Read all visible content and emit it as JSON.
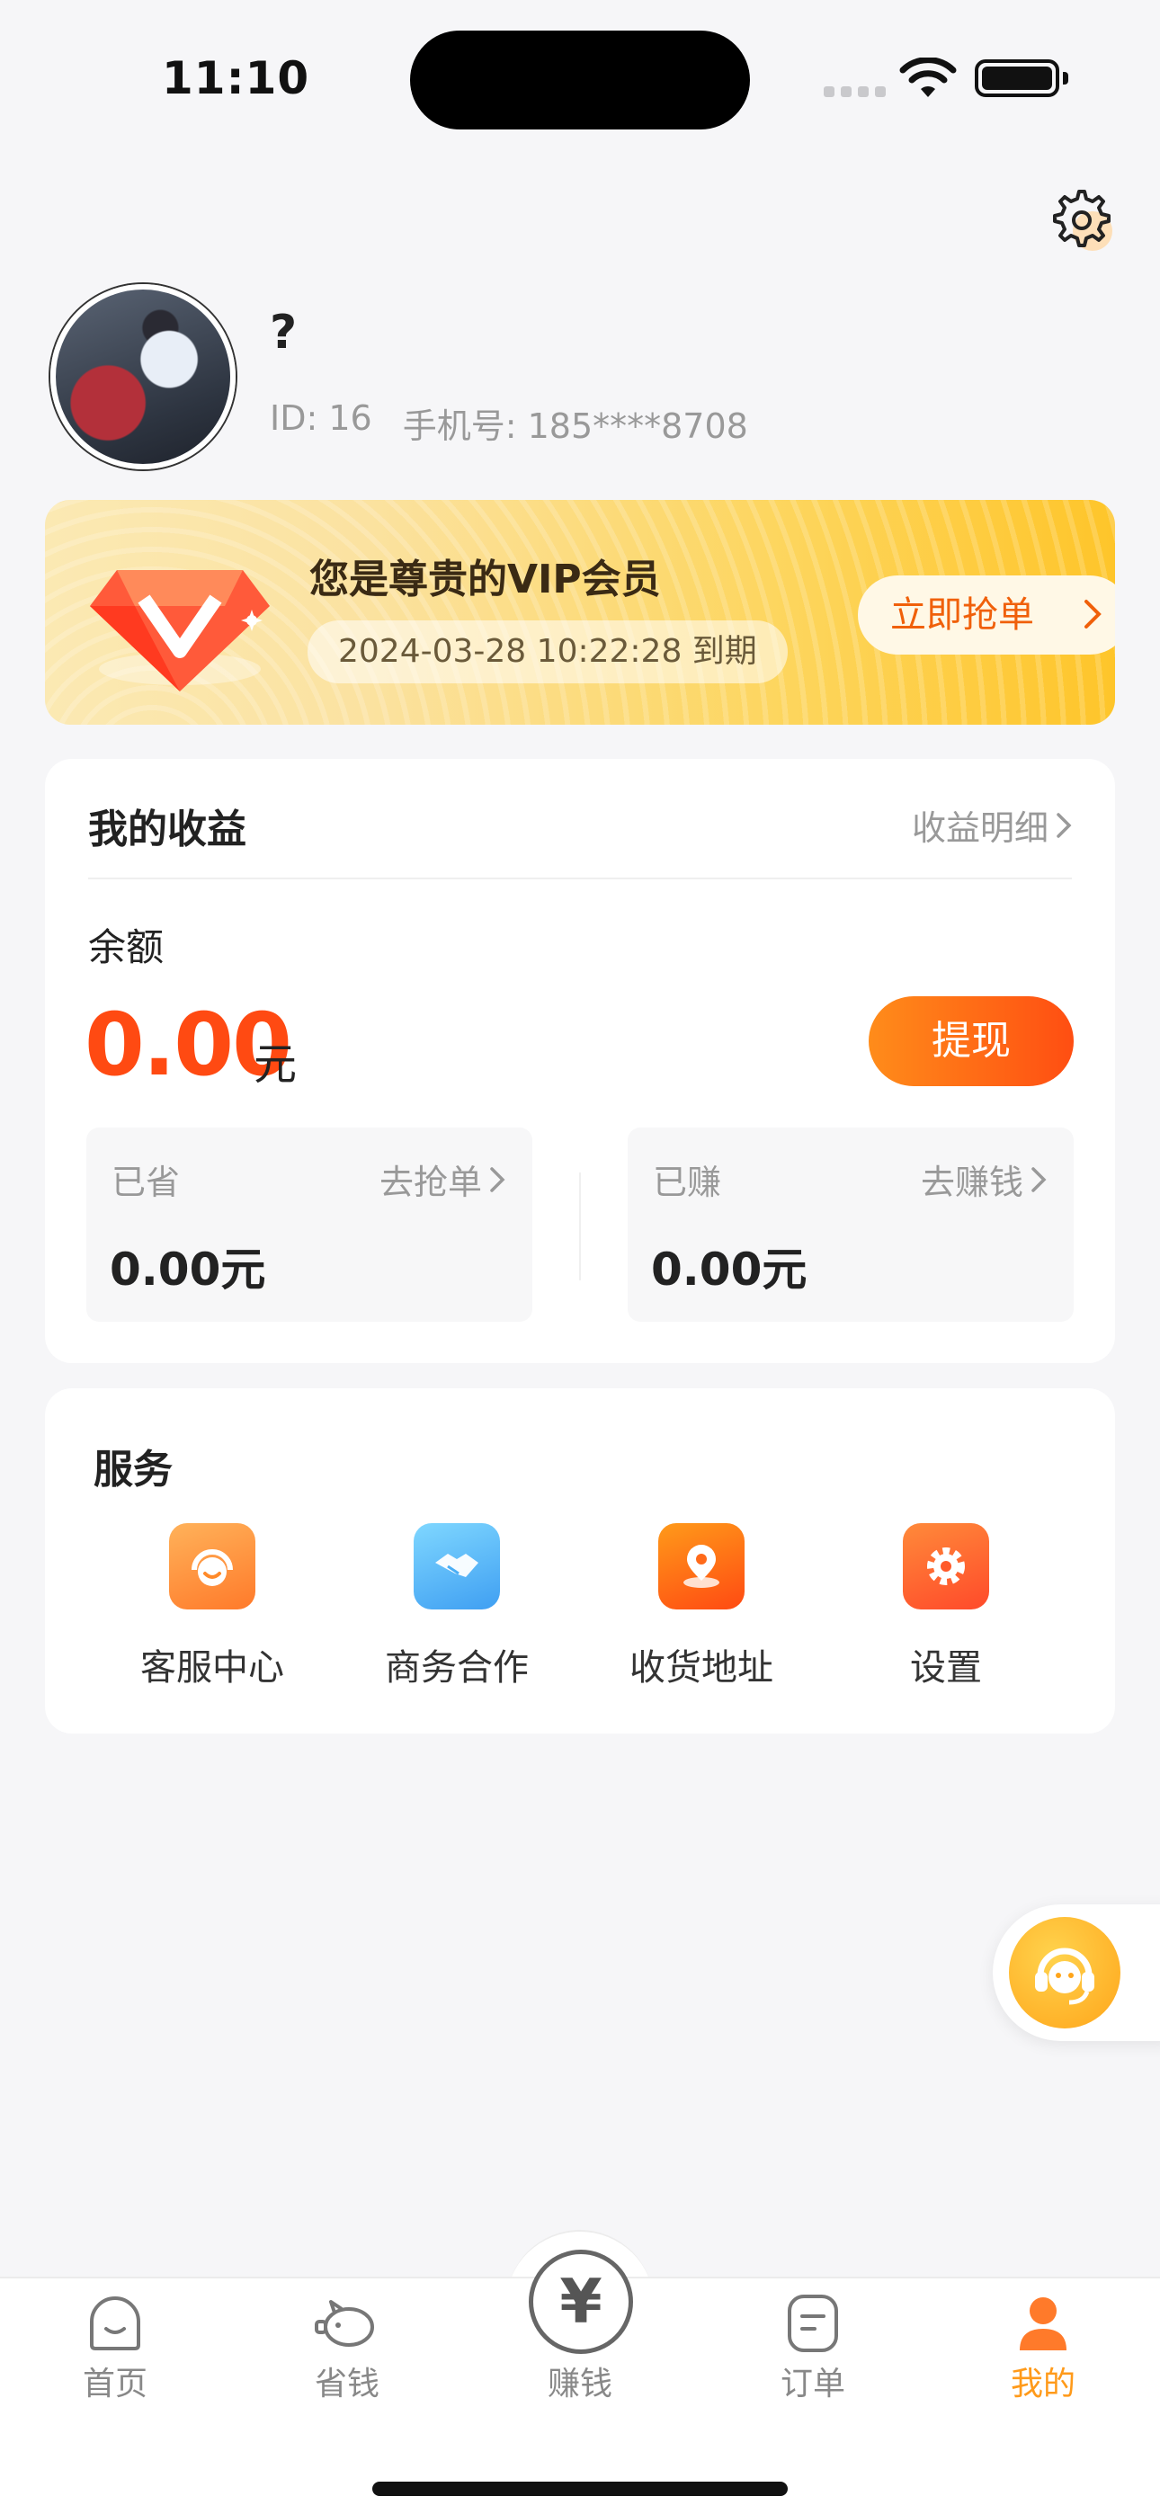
{
  "status_bar": {
    "time": "11:10"
  },
  "profile": {
    "name": "?",
    "id_text": "ID: 16",
    "phone_text": "手机号: 185****8708"
  },
  "vip": {
    "title": "您是尊贵的VIP会员",
    "expire": "2024-03-28 10:22:28 到期",
    "button": "立即抢单"
  },
  "income": {
    "title": "我的收益",
    "detail_link": "收益明细",
    "balance_label": "余额",
    "balance_value": "0.00",
    "balance_unit": "元",
    "withdraw_button": "提现",
    "saved": {
      "label": "已省",
      "link": "去抢单",
      "value": "0.00元"
    },
    "earned": {
      "label": "已赚",
      "link": "去赚钱",
      "value": "0.00元"
    }
  },
  "services": {
    "title": "服务",
    "items": [
      {
        "label": "客服中心",
        "icon": "customer-service-icon",
        "color": "#ff8a2a"
      },
      {
        "label": "商务合作",
        "icon": "handshake-icon",
        "color": "#4aaef5"
      },
      {
        "label": "收货地址",
        "icon": "location-pin-icon",
        "color": "#ff5a1a"
      },
      {
        "label": "设置",
        "icon": "gear-icon",
        "color": "#ff5a2a"
      }
    ]
  },
  "tabbar": {
    "items": [
      {
        "label": "首页",
        "icon": "home-icon"
      },
      {
        "label": "省钱",
        "icon": "piggy-bank-icon"
      },
      {
        "label": "赚钱",
        "icon": "yen-icon"
      },
      {
        "label": "订单",
        "icon": "order-icon"
      },
      {
        "label": "我的",
        "icon": "user-icon",
        "active": true
      }
    ],
    "center_symbol": "¥"
  },
  "colors": {
    "accent": "#ff9a1a",
    "money": "#ff4a12"
  }
}
